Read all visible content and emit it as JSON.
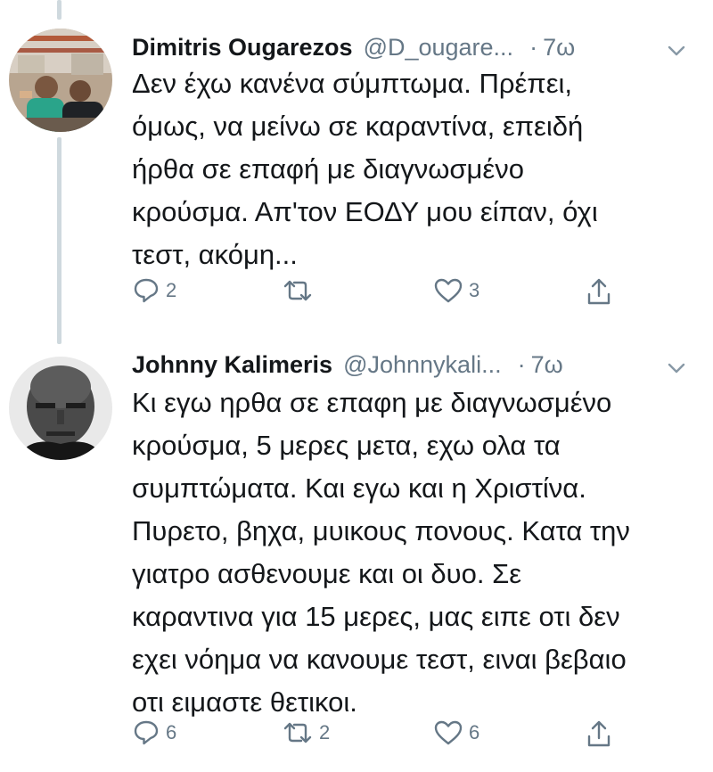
{
  "tweets": [
    {
      "display_name": "Dimitris Ougarezos",
      "handle": "@D_ougare...",
      "time": "7ω",
      "text_lines": [
        "Δεν έχω κανένα σύμπτωμα. Πρέπει,",
        "όμως, να μείνω σε καραντίνα, επειδή",
        "ήρθα σε επαφή με διαγνωσμένο",
        "κρούσμα. Απ'τον ΕΟΔΥ μου είπαν, όχι",
        "τεστ, ακόμη..."
      ],
      "replies": "2",
      "retweets": "",
      "likes": "3"
    },
    {
      "display_name": "Johnny Kalimeris",
      "handle": "@Johnnykali...",
      "time": "7ω",
      "text_lines": [
        "Κι εγω ηρθα σε επαφη με διαγνωσμένο",
        "κρούσμα, 5 μερες μετα, εχω ολα τα",
        "συμπτώματα. Και εγω και η Χριστίνα.",
        "Πυρετο, βηχα, μυικους πονους. Κατα την",
        "γιατρο ασθενουμε και οι δυο. Σε",
        "καραντινα για 15 μερες, μας ειπε οτι δεν",
        "εχει νόημα να κανουμε τεστ, ειναι βεβαιο",
        "οτι ειμαστε θετικοι."
      ],
      "replies": "6",
      "retweets": "2",
      "likes": "6"
    }
  ],
  "icons": {
    "reply": "reply-icon",
    "retweet": "retweet-icon",
    "like": "like-icon",
    "share": "share-icon",
    "more": "chevron-down-icon"
  },
  "colors": {
    "text": "#14171a",
    "muted": "#657786",
    "thread_line": "#cfd9de"
  }
}
